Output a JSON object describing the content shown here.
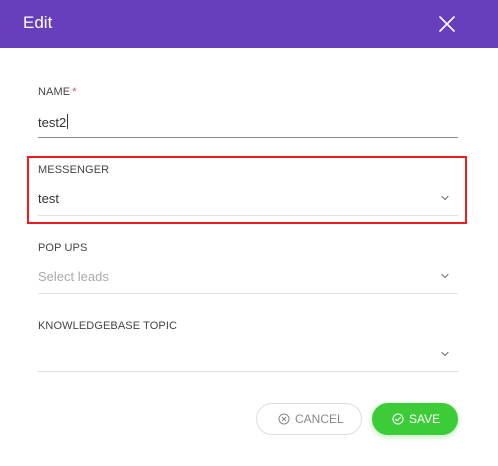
{
  "dialog": {
    "title": "Edit",
    "header_color": "#673fbd"
  },
  "fields": {
    "name": {
      "label": "NAME",
      "required_mark": "*",
      "value": "test2"
    },
    "messenger": {
      "label": "MESSENGER",
      "value": "test",
      "highlighted": true
    },
    "popups": {
      "label": "POP UPS",
      "placeholder": "Select leads"
    },
    "kb_topic": {
      "label": "KNOWLEDGEBASE TOPIC",
      "value": ""
    }
  },
  "actions": {
    "cancel_label": "CANCEL",
    "save_label": "SAVE",
    "save_color": "#3ccc38"
  },
  "icons": {
    "close": "close-icon",
    "chevron": "chevron-down-icon",
    "cancel": "cancel-circle-icon",
    "save": "check-circle-icon"
  },
  "colors": {
    "highlight": "#ee1c1c",
    "required": "#ea475d"
  }
}
